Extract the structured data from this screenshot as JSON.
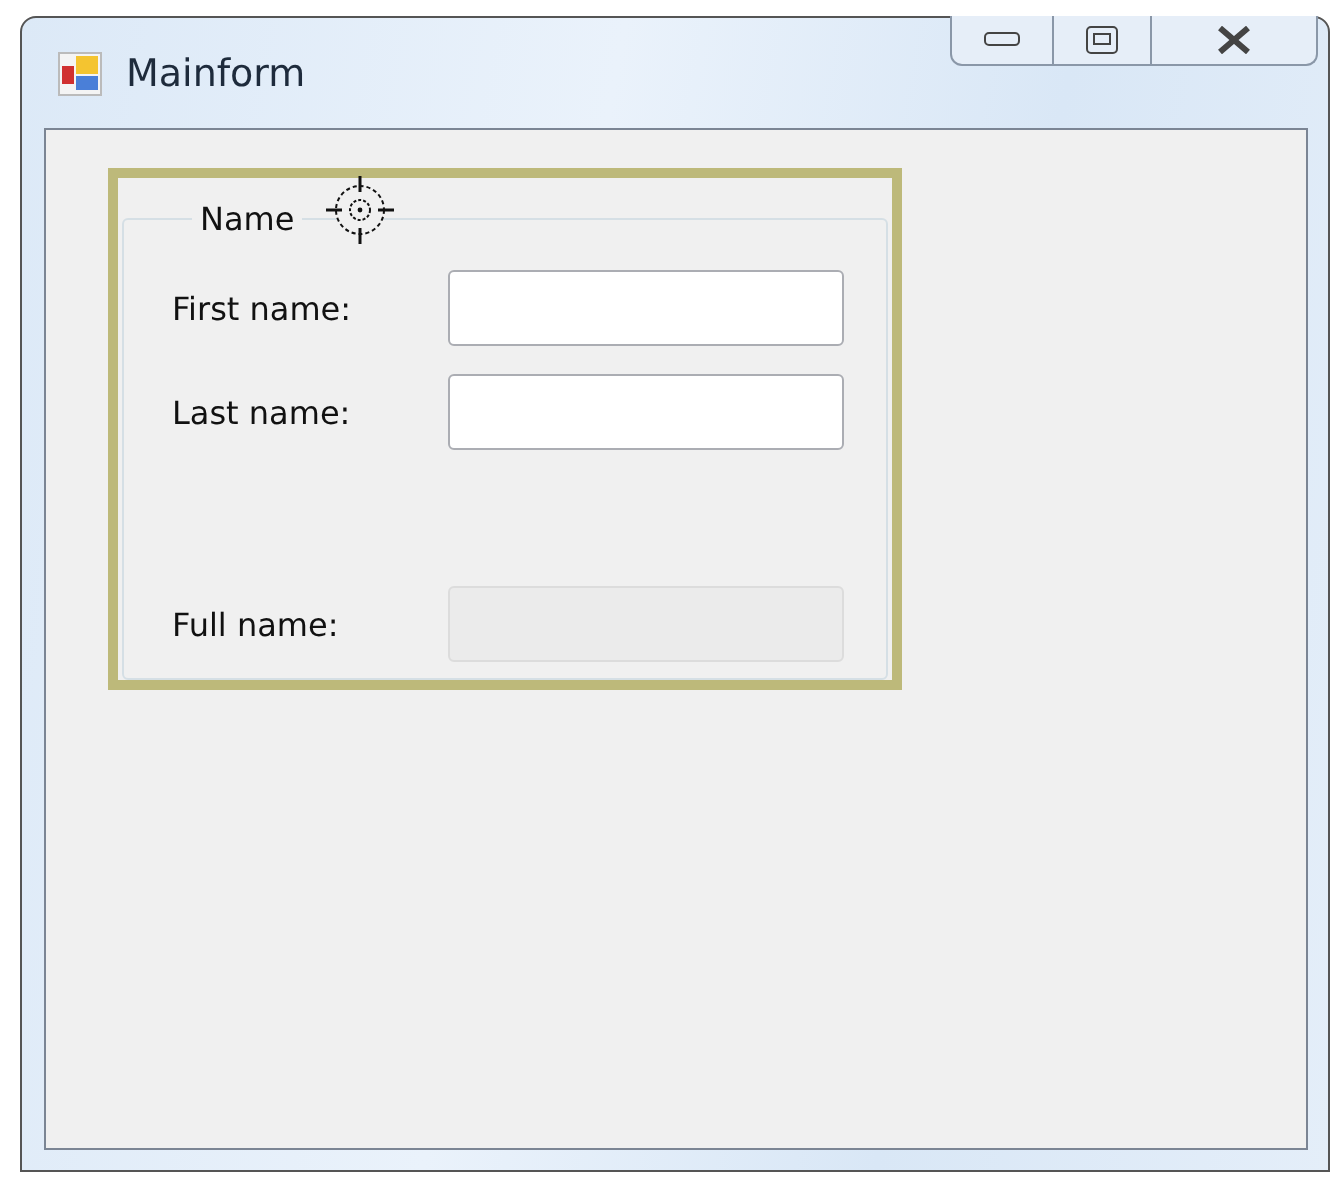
{
  "window": {
    "title": "Mainform"
  },
  "group": {
    "legend": "Name",
    "highlighted": true,
    "fields": [
      {
        "label": "First name:",
        "disabled": false
      },
      {
        "label": "Last name:",
        "disabled": false
      },
      {
        "label": "Full name:",
        "disabled": true
      }
    ]
  }
}
